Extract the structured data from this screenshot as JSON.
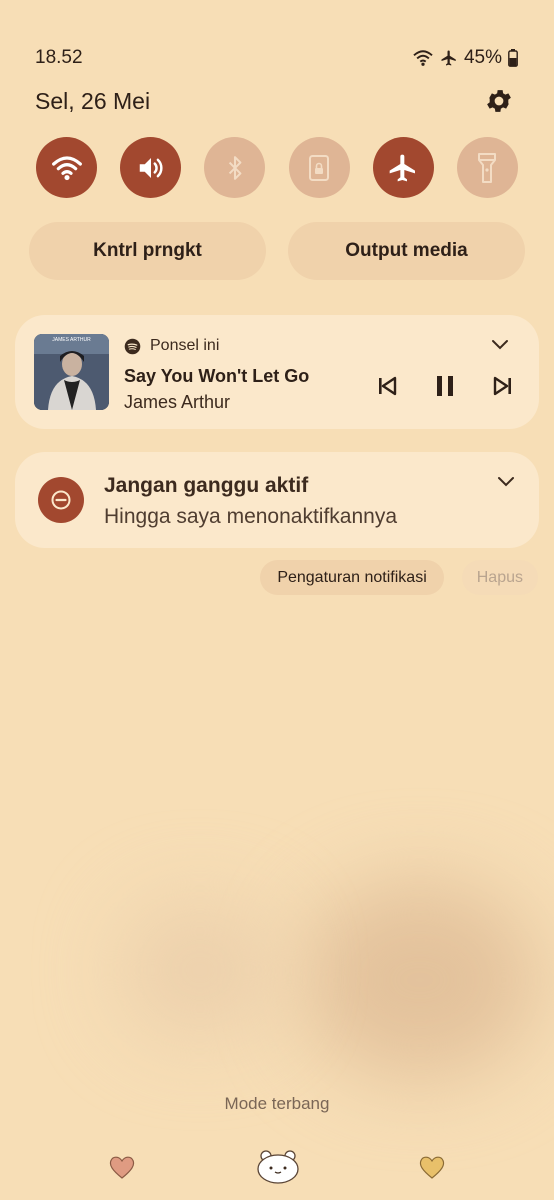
{
  "status_bar": {
    "time": "18.52",
    "battery": "45%"
  },
  "header": {
    "date": "Sel, 26 Mei"
  },
  "quick_toggles": [
    {
      "name": "wifi-icon",
      "state": "on"
    },
    {
      "name": "sound-icon",
      "state": "on"
    },
    {
      "name": "bluetooth-icon",
      "state": "off"
    },
    {
      "name": "rotation-lock-icon",
      "state": "off"
    },
    {
      "name": "airplane-icon",
      "state": "on"
    },
    {
      "name": "flashlight-icon",
      "state": "off"
    }
  ],
  "pills": {
    "device_control": "Kntrl prngkt",
    "media_output": "Output media"
  },
  "media": {
    "source": "Ponsel ini",
    "title": "Say You Won't Let Go",
    "artist": "James Arthur",
    "album_text": "JAMES ARTHUR"
  },
  "dnd": {
    "title": "Jangan ganggu aktif",
    "subtitle": "Hingga saya menonaktifkannya"
  },
  "notification_actions": {
    "settings": "Pengaturan notifikasi",
    "clear": "Hapus"
  },
  "footer": {
    "mode": "Mode terbang"
  },
  "colors": {
    "accent": "#a2482f",
    "accent_off": "#dfb595",
    "background": "#f7deb6",
    "card": "#fbe8cb"
  }
}
